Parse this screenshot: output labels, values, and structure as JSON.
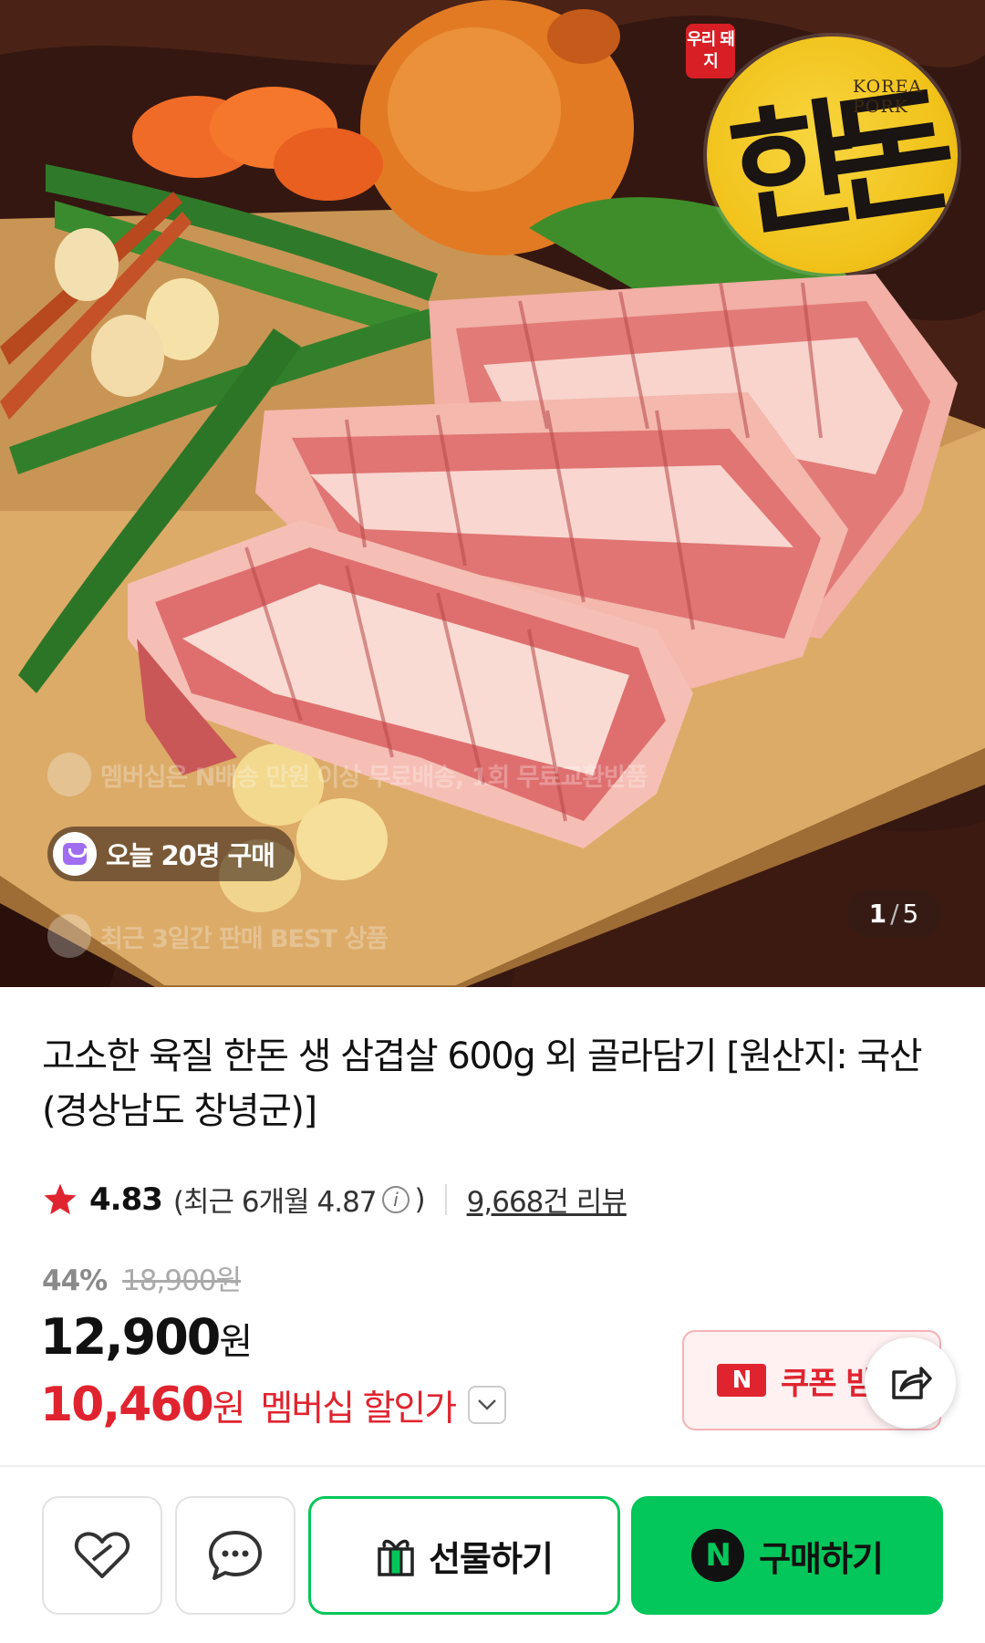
{
  "hero": {
    "badge_text": "우리 돼지",
    "logo_en_1": "KOREA",
    "logo_en_2": "PORK",
    "logo_char": "한돈",
    "overlay_membership": "멤버십은 N배송 만원 이상 무료배송, 1회 무료교환반품",
    "overlay_today": "오늘 20명 구매",
    "overlay_best": "최근 3일간 판매 BEST 상품",
    "image_index": "1",
    "image_total": "5"
  },
  "product": {
    "title": "고소한 육질 한돈 생 삼겹살 600g 외 골라담기 [원산지: 국산(경상남도 창녕군)]",
    "rating": "4.83",
    "recent_prefix": "(최근 6개월 4.87",
    "recent_suffix": ")",
    "reviews": "9,668건 리뷰",
    "discount_pct": "44%",
    "original_price": "18,900원",
    "price": "12,900",
    "price_unit": "원",
    "member_price": "10,460",
    "member_unit": "원",
    "member_label": "멤버십 할인가"
  },
  "coupon": {
    "badge": "N",
    "label": "쿠폰 받"
  },
  "bottom_bar": {
    "gift_label": "선물하기",
    "buy_label": "구매하기",
    "npay_letter": "N"
  },
  "colors": {
    "accent_green": "#03c75a",
    "price_red": "#e0242f",
    "star_red": "#e0242f"
  }
}
